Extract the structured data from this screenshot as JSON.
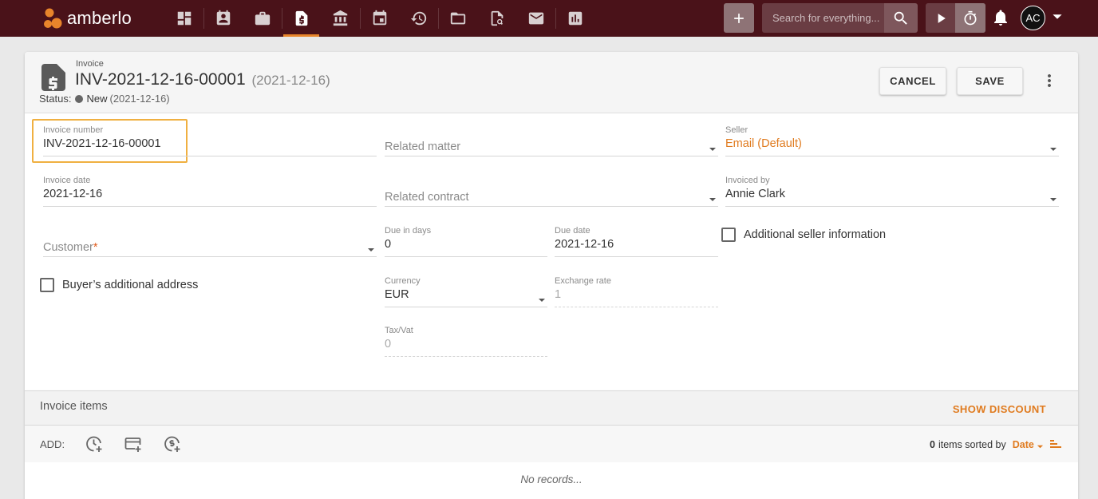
{
  "app": {
    "name": "amberlo",
    "brand_color": "#4a1219",
    "accent_color": "#e8852b"
  },
  "nav": {
    "items": [
      {
        "icon": "dashboard-icon",
        "active": false
      },
      {
        "icon": "contacts-icon",
        "active": false
      },
      {
        "icon": "briefcase-icon",
        "active": false
      },
      {
        "icon": "invoice-icon",
        "active": true
      },
      {
        "icon": "bank-icon",
        "active": false
      },
      {
        "icon": "calendar-icon",
        "active": false
      },
      {
        "icon": "time-history-icon",
        "active": false
      },
      {
        "icon": "folder-icon",
        "active": false
      },
      {
        "icon": "document-search-icon",
        "active": false
      },
      {
        "icon": "mail-icon",
        "active": false
      },
      {
        "icon": "reports-icon",
        "active": false
      }
    ],
    "search_placeholder": "Search for everything...",
    "avatar_initials": "AC"
  },
  "header": {
    "doc_kind": "Invoice",
    "title": "INV-2021-12-16-00001",
    "title_date": "(2021-12-16)",
    "status_label": "Status:",
    "status_value": "New",
    "status_date": "(2021-12-16)",
    "cancel_label": "CANCEL",
    "save_label": "SAVE"
  },
  "form": {
    "invoice_number": {
      "label": "Invoice number",
      "value": "INV-2021-12-16-00001"
    },
    "invoice_date": {
      "label": "Invoice date",
      "value": "2021-12-16"
    },
    "customer": {
      "placeholder": "Customer",
      "required_mark": "*"
    },
    "buyer_address": {
      "label": "Buyer’s additional address"
    },
    "related_matter": {
      "placeholder": "Related matter"
    },
    "related_contract": {
      "placeholder": "Related contract"
    },
    "due_in_days": {
      "label": "Due in days",
      "value": "0"
    },
    "due_date": {
      "label": "Due date",
      "value": "2021-12-16"
    },
    "currency": {
      "label": "Currency",
      "value": "EUR"
    },
    "exchange_rate": {
      "label": "Exchange rate",
      "value": "1"
    },
    "tax_vat": {
      "label": "Tax/Vat",
      "value": "0"
    },
    "seller": {
      "label": "Seller",
      "value": "Email (Default)"
    },
    "invoiced_by": {
      "label": "Invoiced by",
      "value": "Annie Clark"
    },
    "additional_seller": {
      "label": "Additional seller information"
    }
  },
  "items": {
    "title": "Invoice items",
    "show_discount": "SHOW DISCOUNT",
    "add_label": "ADD:",
    "count": "0",
    "sorted_by_text": "items sorted by",
    "sort_field": "Date",
    "empty_text": "No records..."
  }
}
